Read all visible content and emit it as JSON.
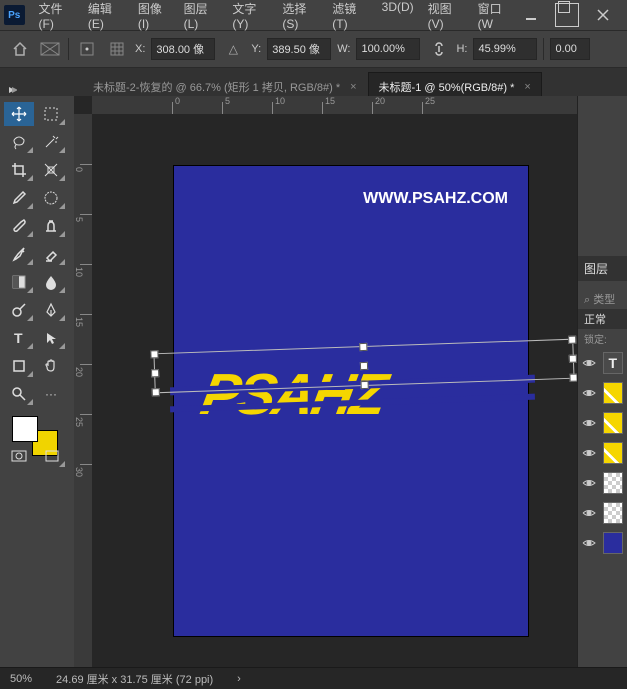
{
  "menu": {
    "file": "文件(F)",
    "edit": "编辑(E)",
    "image": "图像(I)",
    "layer": "图层(L)",
    "text": "文字(Y)",
    "select": "选择(S)",
    "filter": "滤镜(T)",
    "threed": "3D(D)",
    "view": "视图(V)",
    "window": "窗口(W"
  },
  "optbar": {
    "x_label": "X:",
    "x_val": "308.00 像",
    "y_label": "Y:",
    "y_val": "389.50 像",
    "w_label": "W:",
    "w_val": "100.00%",
    "h_label": "H:",
    "h_val": "45.99%",
    "angle_val": "0.00"
  },
  "tabs": {
    "tab1": "未标题-2-恢复的 @ 66.7% (矩形 1 拷贝, RGB/8#) *",
    "tab2": "未标题-1 @ 50%(RGB/8#) *"
  },
  "ruler": {
    "h": [
      "0",
      "5",
      "10",
      "15",
      "20",
      "25"
    ],
    "v": [
      "0",
      "5",
      "10",
      "15",
      "20",
      "25",
      "30"
    ]
  },
  "canvas": {
    "url": "WWW.PSAHZ.COM",
    "main_text": "PSAHZ"
  },
  "layers": {
    "tab": "图层",
    "search": "类型",
    "blend": "正常",
    "lock": "锁定: ",
    "t_label": "T"
  },
  "status": {
    "zoom": "50%",
    "dims": "24.69 厘米 x 31.75 厘米 (72 ppi)"
  },
  "search_icon": "⌕"
}
